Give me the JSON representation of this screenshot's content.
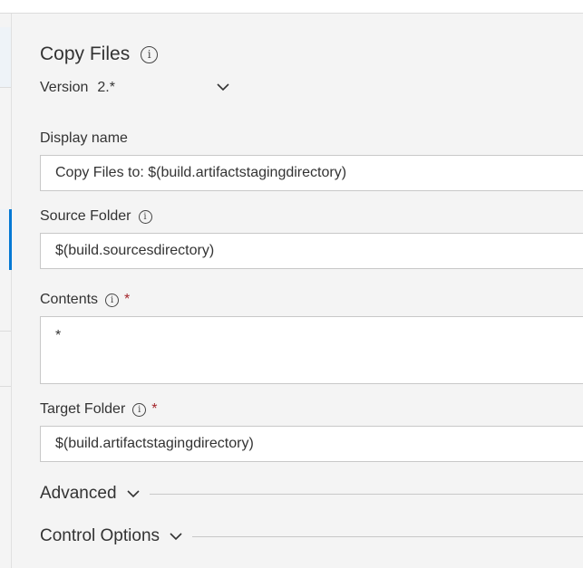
{
  "task": {
    "title": "Copy Files",
    "version_label": "Version",
    "version_value": "2.*"
  },
  "fields": {
    "display_name": {
      "label": "Display name",
      "value": "Copy Files to: $(build.artifactstagingdirectory)"
    },
    "source_folder": {
      "label": "Source Folder",
      "value": "$(build.sourcesdirectory)"
    },
    "contents": {
      "label": "Contents",
      "required_mark": "*",
      "value": "*"
    },
    "target_folder": {
      "label": "Target Folder",
      "required_mark": "*",
      "value": "$(build.artifactstagingdirectory)"
    }
  },
  "sections": {
    "advanced": "Advanced",
    "control_options": "Control Options"
  },
  "icons": {
    "info": "info-icon",
    "chevron": "chevron-down-icon"
  },
  "colors": {
    "required": "#a4262c",
    "accent": "#0078d4",
    "background": "#f4f4f4"
  }
}
